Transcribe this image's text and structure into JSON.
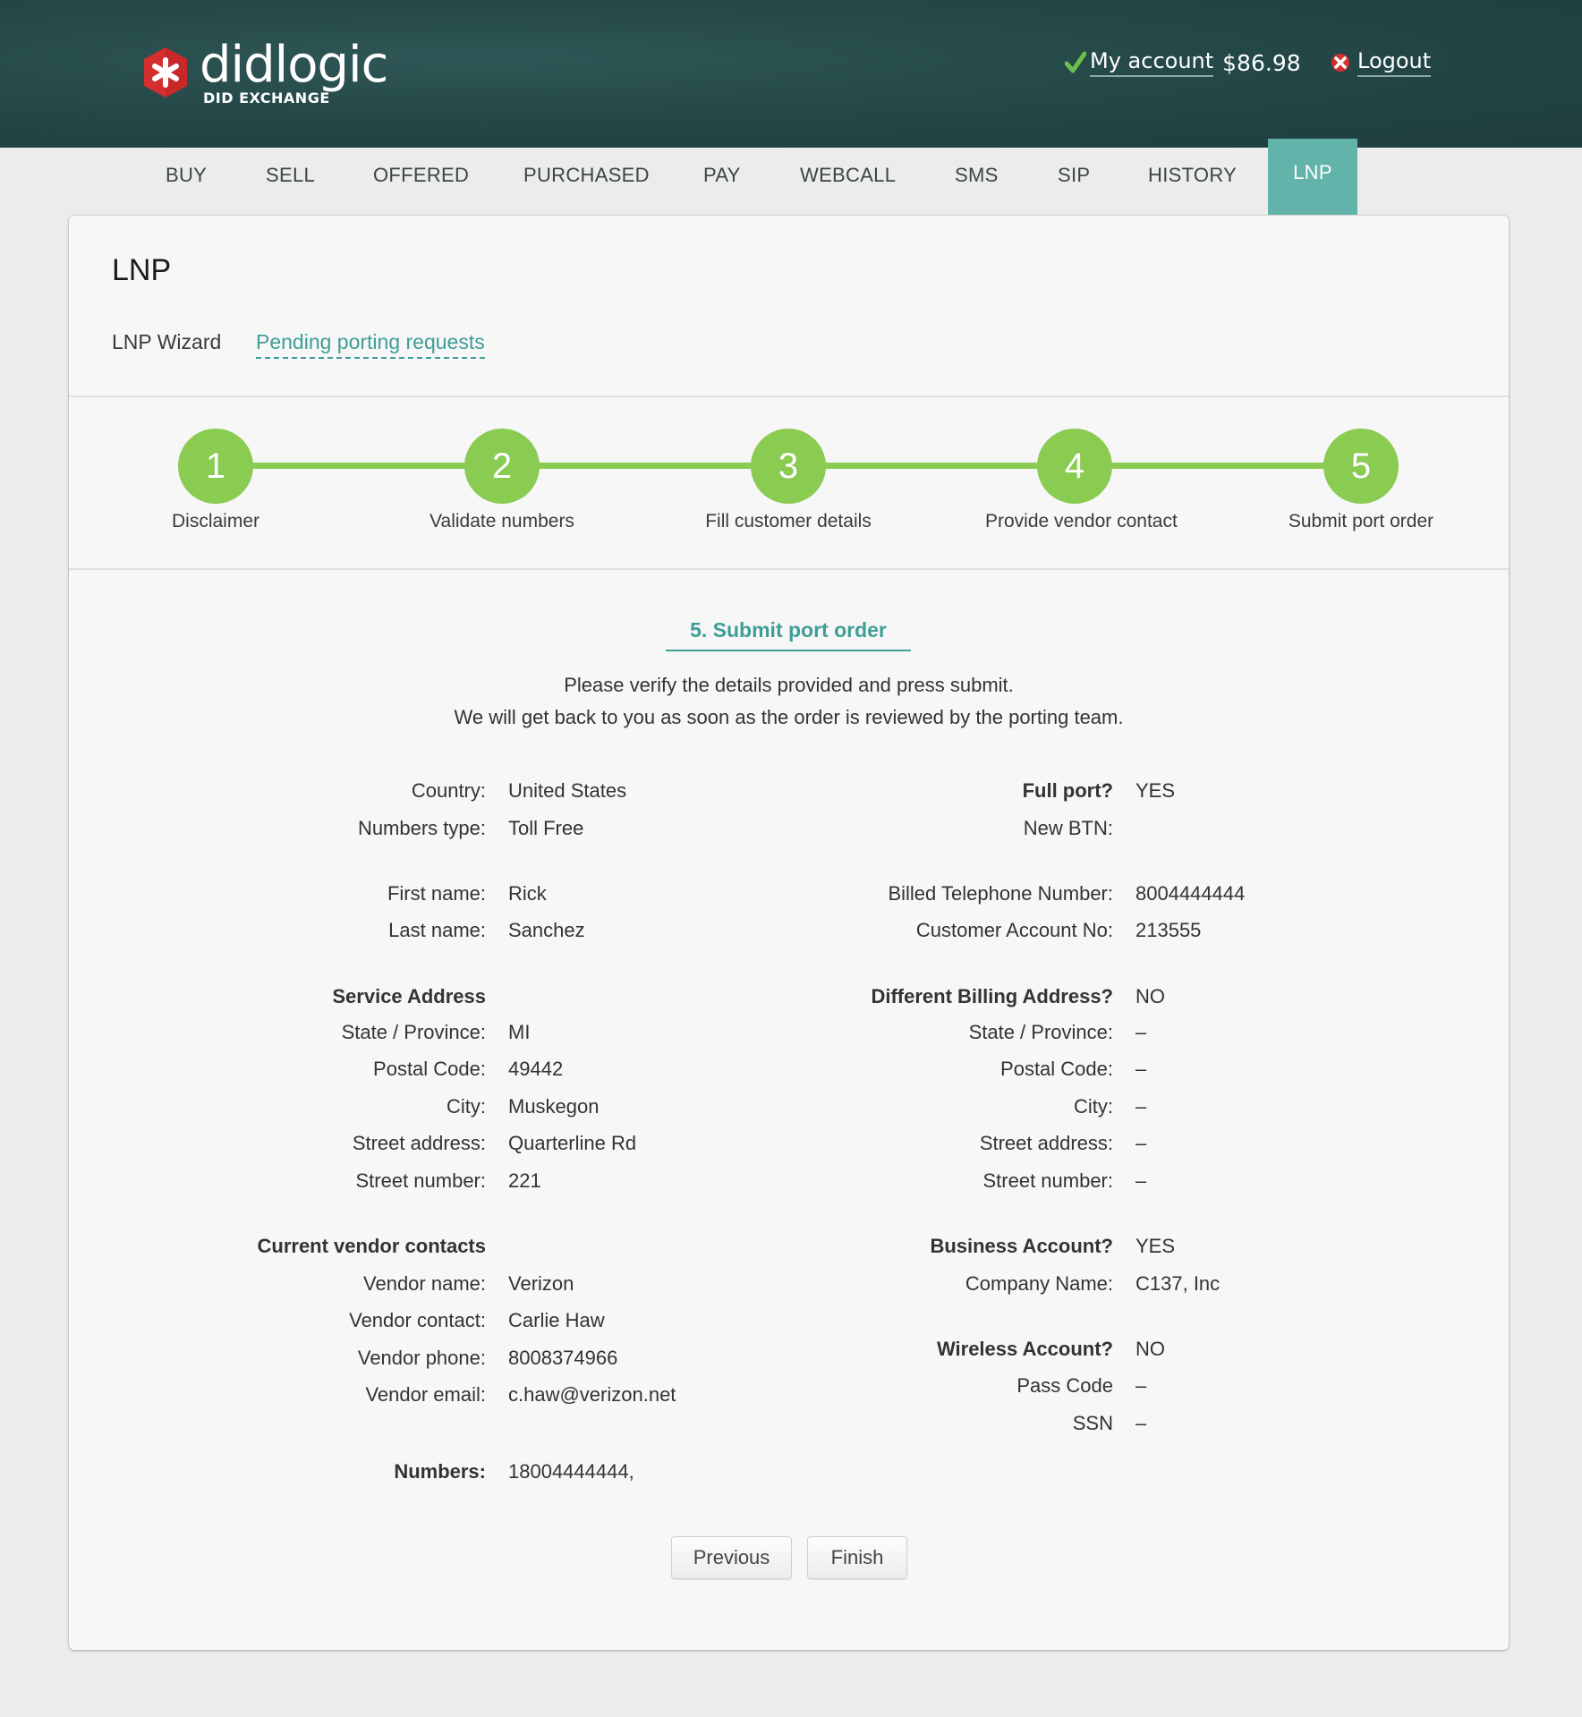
{
  "brand": {
    "name": "didlogic",
    "tagline": "DID EXCHANGE",
    "logo_color": "#d32f2f"
  },
  "header": {
    "account_label": "My account",
    "balance": "$86.98",
    "logout_label": "Logout"
  },
  "nav": {
    "items": [
      {
        "label": "BUY"
      },
      {
        "label": "SELL"
      },
      {
        "label": "OFFERED"
      },
      {
        "label": "PURCHASED"
      },
      {
        "label": "PAY"
      },
      {
        "label": "WEBCALL"
      },
      {
        "label": "SMS"
      },
      {
        "label": "SIP"
      },
      {
        "label": "HISTORY"
      },
      {
        "label": "LNP",
        "active": true
      }
    ],
    "active_color": "#62b3aa"
  },
  "page": {
    "title": "LNP",
    "subtabs": [
      {
        "label": "LNP Wizard"
      },
      {
        "label": "Pending porting requests"
      }
    ]
  },
  "wizard": {
    "steps": [
      {
        "number": "1",
        "label": "Disclaimer"
      },
      {
        "number": "2",
        "label": "Validate numbers"
      },
      {
        "number": "3",
        "label": "Fill customer details"
      },
      {
        "number": "4",
        "label": "Provide vendor contact"
      },
      {
        "number": "5",
        "label": "Submit port order"
      }
    ],
    "current_step": 5,
    "step_color": "#8acb52"
  },
  "summary": {
    "section_title": "5. Submit port order",
    "description_line1": "Please verify the details provided and press submit.",
    "description_line2": "We will get back to you as soon as the order is reviewed by the porting team.",
    "left": [
      {
        "label": "Country:",
        "value": "United States"
      },
      {
        "label": "Numbers type:",
        "value": "Toll Free"
      },
      {
        "label": "First name:",
        "value": "Rick"
      },
      {
        "label": "Last name:",
        "value": "Sanchez"
      },
      {
        "label": "Service Address",
        "value": "",
        "heading": true
      },
      {
        "label": "State / Province:",
        "value": "MI"
      },
      {
        "label": "Postal Code:",
        "value": "49442"
      },
      {
        "label": "City:",
        "value": "Muskegon"
      },
      {
        "label": "Street address:",
        "value": "Quarterline Rd"
      },
      {
        "label": "Street number:",
        "value": "221"
      },
      {
        "label": "Current vendor contacts",
        "value": "",
        "heading": true
      },
      {
        "label": "Vendor name:",
        "value": "Verizon"
      },
      {
        "label": "Vendor contact:",
        "value": "Carlie Haw"
      },
      {
        "label": "Vendor phone:",
        "value": "8008374966"
      },
      {
        "label": "Vendor email:",
        "value": "c.haw@verizon.net"
      },
      {
        "label": "Numbers:",
        "value": "18004444444,",
        "heading": true
      }
    ],
    "right": [
      {
        "label": "Full port?",
        "value": "YES",
        "heading": true
      },
      {
        "label": "New BTN:",
        "value": ""
      },
      {
        "label": "Billed Telephone Number:",
        "value": "8004444444"
      },
      {
        "label": "Customer Account No:",
        "value": "213555"
      },
      {
        "label": "Different Billing Address?",
        "value": "NO",
        "heading": true
      },
      {
        "label": "State / Province:",
        "value": "–"
      },
      {
        "label": "Postal Code:",
        "value": "–"
      },
      {
        "label": "City:",
        "value": "–"
      },
      {
        "label": "Street address:",
        "value": "–"
      },
      {
        "label": "Street number:",
        "value": "–"
      },
      {
        "label": "Business Account?",
        "value": "YES",
        "heading": true
      },
      {
        "label": "Company Name:",
        "value": "C137, Inc"
      },
      {
        "label": "Wireless Account?",
        "value": "NO",
        "heading": true
      },
      {
        "label": "Pass Code",
        "value": "–"
      },
      {
        "label": "SSN",
        "value": "–"
      }
    ]
  },
  "actions": {
    "previous_label": "Previous",
    "finish_label": "Finish"
  }
}
